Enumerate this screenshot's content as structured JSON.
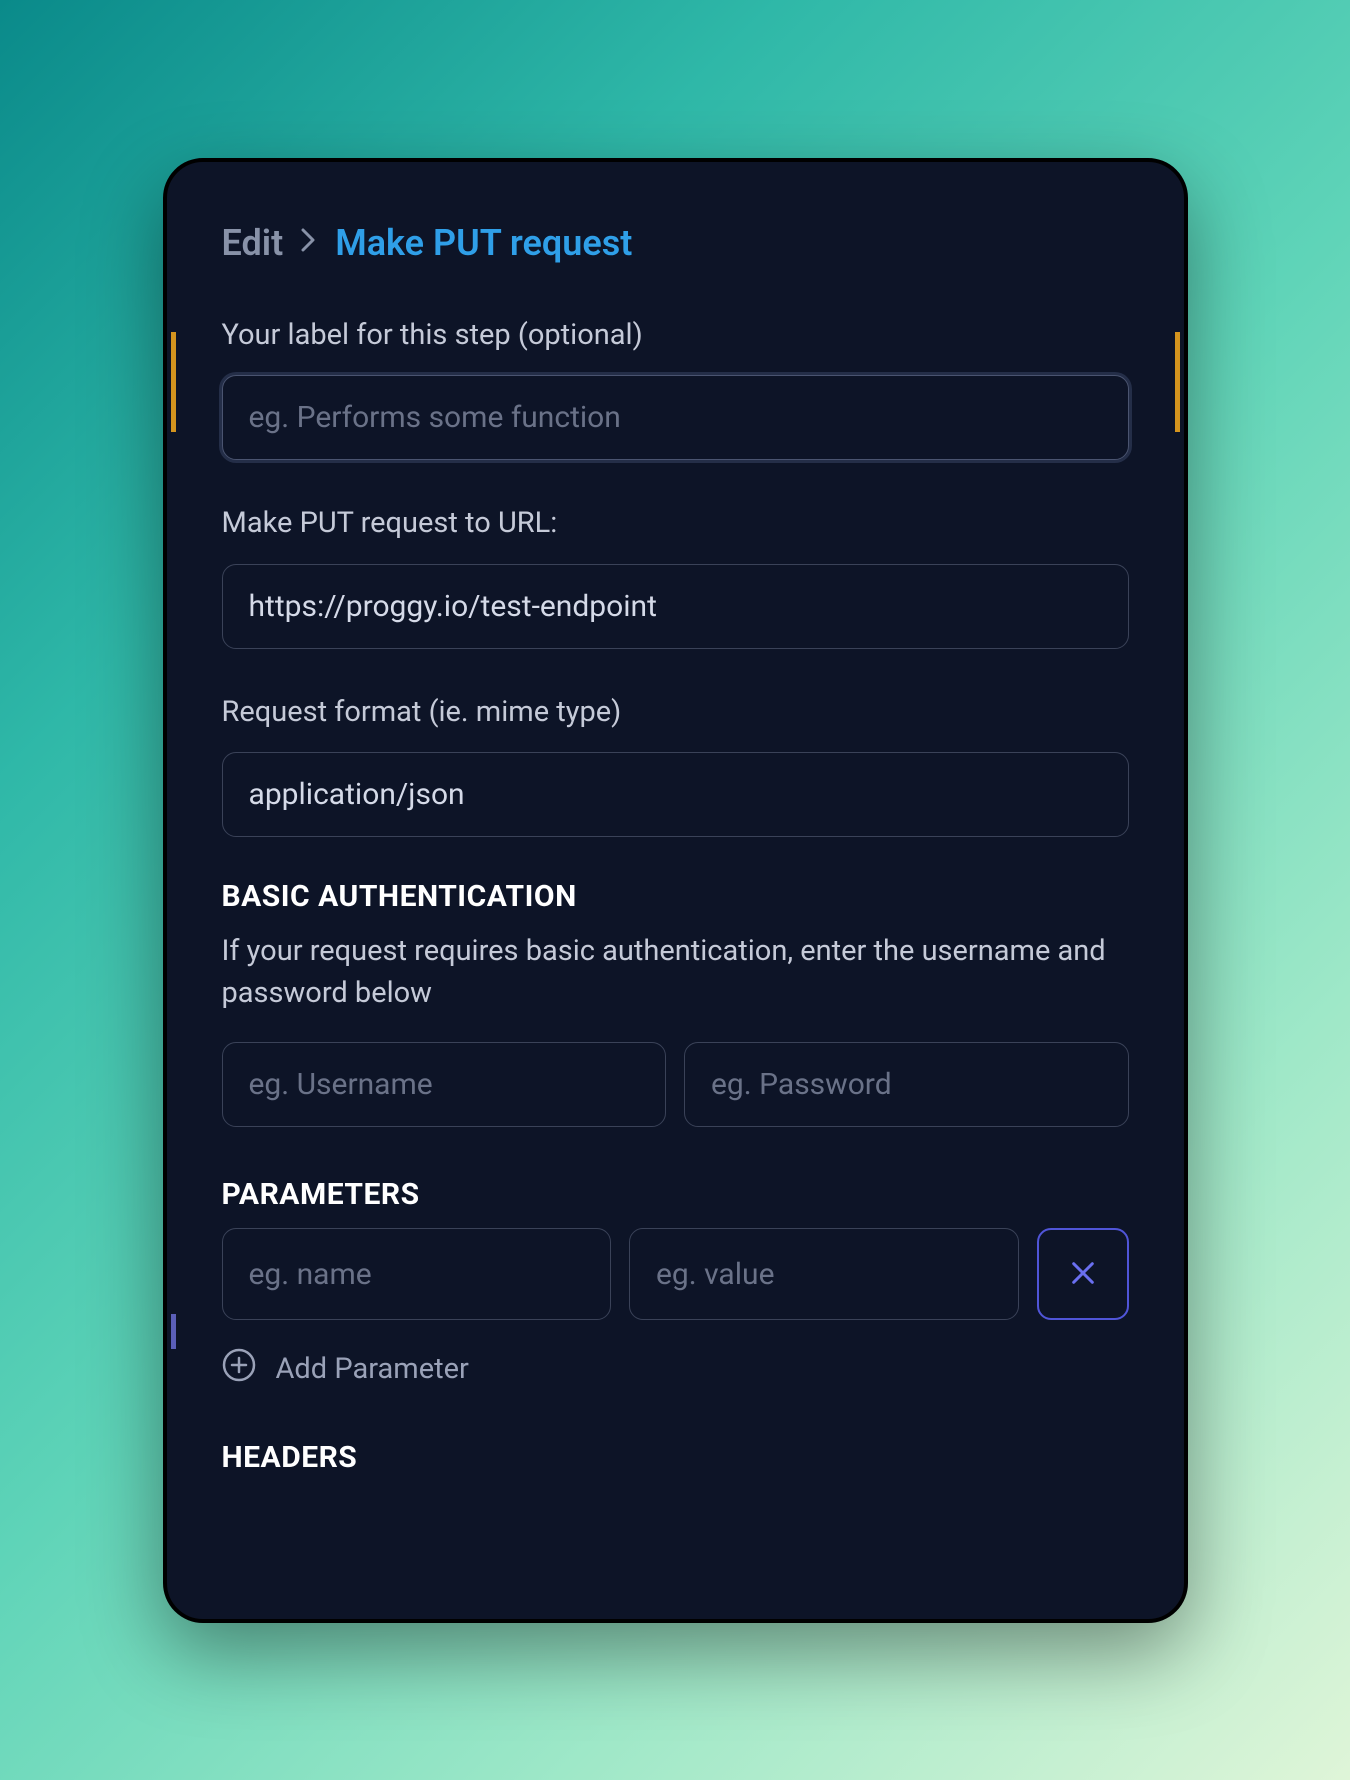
{
  "breadcrumb": {
    "root": "Edit",
    "current": "Make PUT request"
  },
  "form": {
    "label_field": {
      "label": "Your label for this step (optional)",
      "placeholder": "eg. Performs some function",
      "value": ""
    },
    "url_field": {
      "label": "Make PUT request to URL:",
      "value": "https://proggy.io/test-endpoint"
    },
    "format_field": {
      "label": "Request format (ie. mime type)",
      "value": "application/json"
    }
  },
  "auth": {
    "heading": "BASIC AUTHENTICATION",
    "description": "If your request requires basic authentication, enter the username and password below",
    "username_placeholder": "eg. Username",
    "password_placeholder": "eg. Password"
  },
  "parameters": {
    "heading": "PARAMETERS",
    "name_placeholder": "eg. name",
    "value_placeholder": "eg. value",
    "add_label": "Add Parameter"
  },
  "headers": {
    "heading": "HEADERS"
  }
}
